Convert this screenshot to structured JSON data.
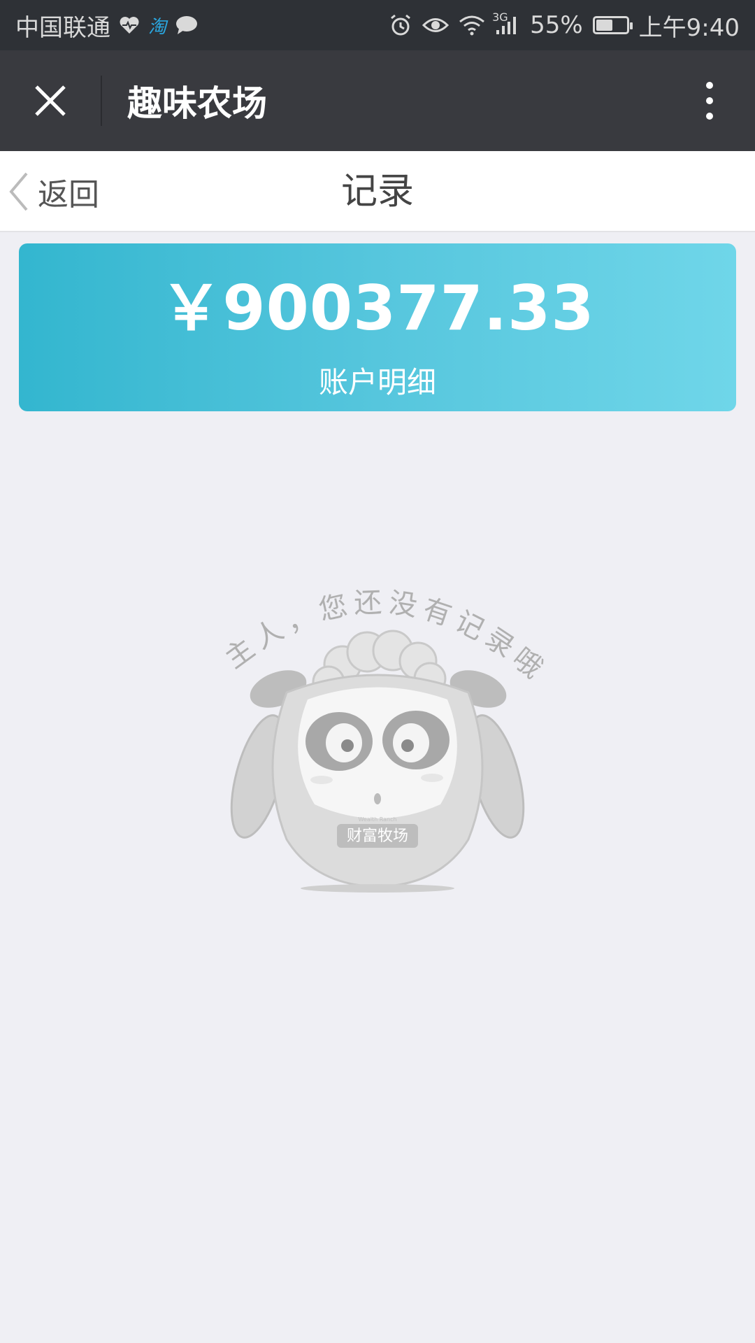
{
  "status_bar": {
    "carrier": "中国联通",
    "network": "3G",
    "battery": "55%",
    "battery_level": 0.55,
    "time": "上午9:40",
    "taobao_glyph": "淘"
  },
  "header": {
    "title": "趣味农场"
  },
  "nav": {
    "back_label": "返回",
    "title": "记录"
  },
  "balance": {
    "amount": "￥900377.33",
    "label": "账户明细"
  },
  "empty_state": {
    "message": "主人，您还没有记录哦",
    "badge": "财富牧场",
    "badge_small": "Wealth Ranch"
  },
  "colors": {
    "statusbar": "#2e3136",
    "appbar": "#393a3f",
    "card_start": "#33b6cf",
    "card_end": "#6fd6e9",
    "page_bg": "#efeff4"
  }
}
